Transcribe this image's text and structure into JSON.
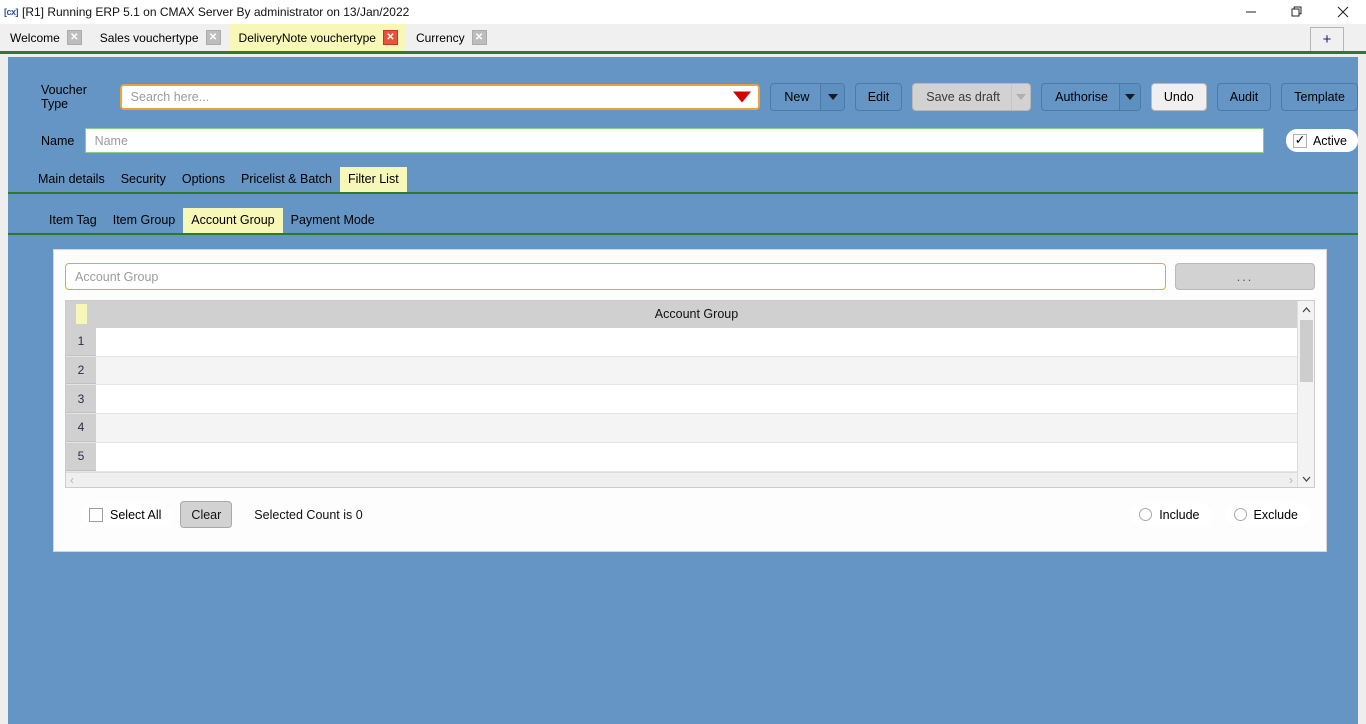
{
  "window": {
    "logo": "cx-logo-icon",
    "title": "[R1] Running ERP 5.1 on CMAX Server By administrator on 13/Jan/2022",
    "controls": {
      "minimize": "—",
      "restore": "❐",
      "close": "✕"
    }
  },
  "tabstrip": {
    "tabs": [
      {
        "label": "Welcome",
        "close": "✕",
        "active": false
      },
      {
        "label": "Sales vouchertype",
        "close": "✕",
        "active": false
      },
      {
        "label": "DeliveryNote vouchertype",
        "close": "✕",
        "active": true
      },
      {
        "label": "Currency",
        "close": "✕",
        "active": false
      }
    ],
    "add_tab_label": "+"
  },
  "form": {
    "voucher_type_label": "Voucher Type",
    "voucher_type_placeholder": "Search here...",
    "voucher_type_value": "",
    "name_label": "Name",
    "name_placeholder": "Name",
    "name_value": "",
    "active_label": "Active",
    "active_checked": true,
    "active_mark": "✓"
  },
  "toolbar": {
    "new_label": "New",
    "edit_label": "Edit",
    "save_as_draft_label": "Save as draft",
    "authorise_label": "Authorise",
    "undo_label": "Undo",
    "audit_label": "Audit",
    "template_label": "Template"
  },
  "main_tabs": [
    {
      "label": "Main details",
      "active": false
    },
    {
      "label": "Security",
      "active": false
    },
    {
      "label": "Options",
      "active": false
    },
    {
      "label": "Pricelist & Batch",
      "active": false
    },
    {
      "label": "Filter List",
      "active": true
    }
  ],
  "sub_tabs": [
    {
      "label": "Item Tag",
      "active": false
    },
    {
      "label": "Item Group",
      "active": false
    },
    {
      "label": "Account Group",
      "active": true
    },
    {
      "label": "Payment Mode",
      "active": false
    }
  ],
  "panel": {
    "filter_placeholder": "Account Group",
    "filter_value": "",
    "browse_label": "...",
    "grid": {
      "column_header": "Account Group",
      "rows": [
        {
          "num": "1",
          "value": ""
        },
        {
          "num": "2",
          "value": ""
        },
        {
          "num": "3",
          "value": ""
        },
        {
          "num": "4",
          "value": ""
        },
        {
          "num": "5",
          "value": ""
        }
      ],
      "scroll_up": "⌃",
      "scroll_down": "⌄",
      "scroll_left": "‹",
      "scroll_right": "›"
    },
    "footer": {
      "select_all_label": "Select All",
      "select_all_checked": false,
      "clear_label": "Clear",
      "selected_count_text": "Selected Count is 0",
      "include_label": "Include",
      "exclude_label": "Exclude",
      "include_selected": false,
      "exclude_selected": false
    }
  },
  "colors": {
    "workarea_blue": "#6595c5",
    "active_tab_yellow": "#f7f7b8",
    "accent_orange": "#e8a33d",
    "green_rule": "#2d7a2d",
    "caret_red": "#d40000",
    "close_red": "#e8533a"
  }
}
